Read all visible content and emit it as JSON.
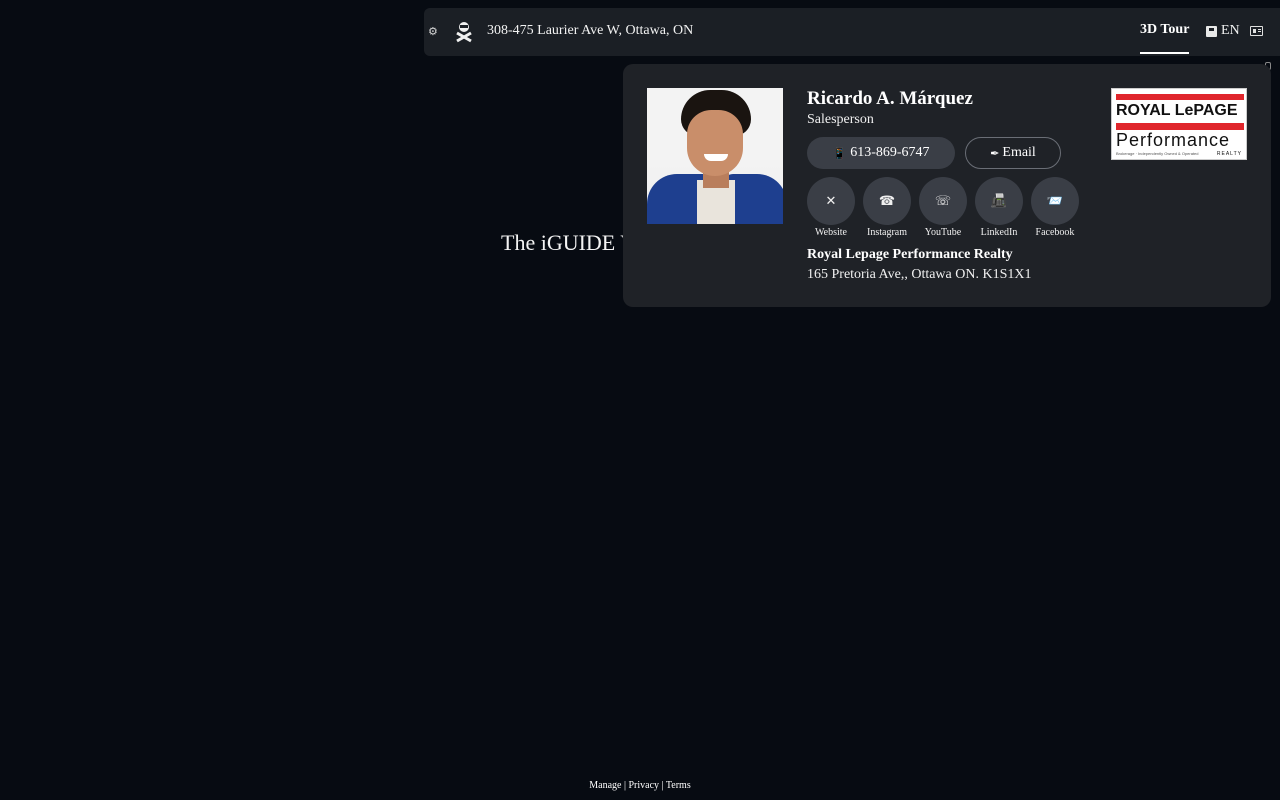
{
  "topbar": {
    "address": "308-475 Laurier Ave W, Ottawa, ON",
    "tour_tab": "3D Tour",
    "language": "EN",
    "settings_icon": "gear-icon",
    "logo_icon": "iguide-logo-icon",
    "card_icon": "contact-card-icon"
  },
  "viewer": {
    "locked_message": "The iGUIDE View is locked."
  },
  "agent": {
    "name": "Ricardo A. Márquez",
    "title": "Salesperson",
    "phone_icon": "📱",
    "phone": "613-869-6747",
    "email_icon": "✒",
    "email_label": "Email",
    "socials": [
      {
        "icon": "✕",
        "label": "Website"
      },
      {
        "icon": "☎",
        "label": "Instagram"
      },
      {
        "icon": "☏",
        "label": "YouTube"
      },
      {
        "icon": "📠",
        "label": "LinkedIn"
      },
      {
        "icon": "📨",
        "label": "Facebook"
      }
    ],
    "brokerage": "Royal Lepage Performance Realty",
    "address": "165 Pretoria Ave,, Ottawa ON. K1S1X1"
  },
  "brand": {
    "line1": "ROYAL LePAGE",
    "line2": "Performance",
    "line3": "Brokerage · Independently Owned & Operated",
    "line4": "REALTY",
    "accent_color": "#e0262c"
  },
  "footer": {
    "manage": "Manage",
    "privacy": "Privacy",
    "terms": "Terms",
    "separator": "|"
  }
}
